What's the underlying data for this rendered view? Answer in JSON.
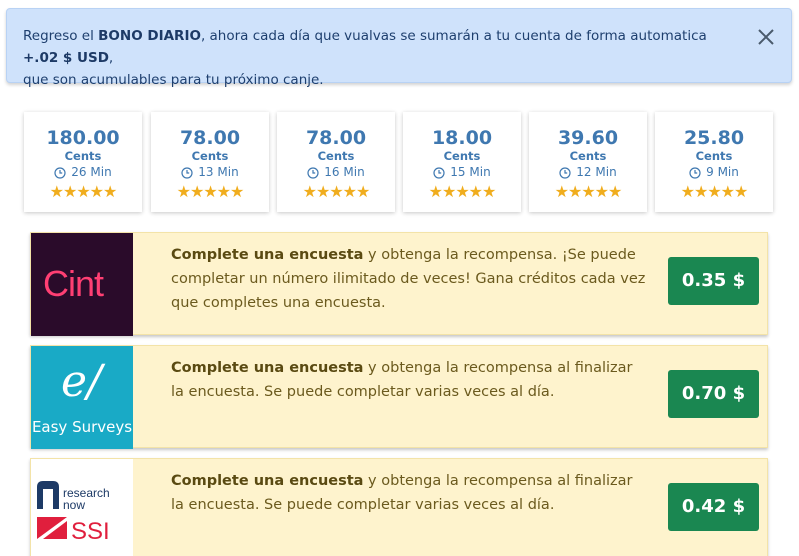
{
  "banner": {
    "prefix": "Regreso el ",
    "bold1": "BONO DIARIO",
    "middle": ", ahora cada día que vualvas se sumarán a tu cuenta de forma automatica ",
    "bold2": "+.02 $ USD",
    "suffix": ",",
    "line2": "que son acumulables para tu próximo canje."
  },
  "cards": [
    {
      "amount": "180.00",
      "unit": "Cents",
      "time": "26 Min",
      "stars": "★★★★★"
    },
    {
      "amount": "78.00",
      "unit": "Cents",
      "time": "13 Min",
      "stars": "★★★★★"
    },
    {
      "amount": "78.00",
      "unit": "Cents",
      "time": "16 Min",
      "stars": "★★★★★"
    },
    {
      "amount": "18.00",
      "unit": "Cents",
      "time": "15 Min",
      "stars": "★★★★★"
    },
    {
      "amount": "39.60",
      "unit": "Cents",
      "time": "12 Min",
      "stars": "★★★★★"
    },
    {
      "amount": "25.80",
      "unit": "Cents",
      "time": "9 Min",
      "stars": "★★★★★"
    }
  ],
  "offers": [
    {
      "logo_text": "Cint",
      "bold": "Complete una encuesta",
      "text": " y obtenga la recompensa. ¡Se puede completar un número ilimitado de veces! Gana créditos cada vez que completes una encuesta.",
      "button": "0.35 $"
    },
    {
      "logo_text": "Easy Surveys",
      "logo_mark": "e/",
      "bold": "Complete una encuesta",
      "text": " y obtenga la recompensa al finalizar la encuesta. Se puede completar varias veces al día.",
      "button": "0.70 $"
    },
    {
      "logo_line1": "research",
      "logo_line2": "now",
      "logo_line3": "SSI",
      "bold": "Complete una encuesta",
      "text": " y obtenga la recompensa al finalizar la encuesta. Se puede completar varias veces al día.",
      "button": "0.42 $"
    }
  ],
  "colors": {
    "banner_bg": "#cfe2fb",
    "card_text": "#3f78b0",
    "star": "#f0ad1e",
    "offer_bg": "#fef3cd",
    "button_bg": "#1a8751"
  },
  "icons": {
    "close": "close-icon",
    "clock": "clock-icon",
    "star": "star-icon"
  }
}
